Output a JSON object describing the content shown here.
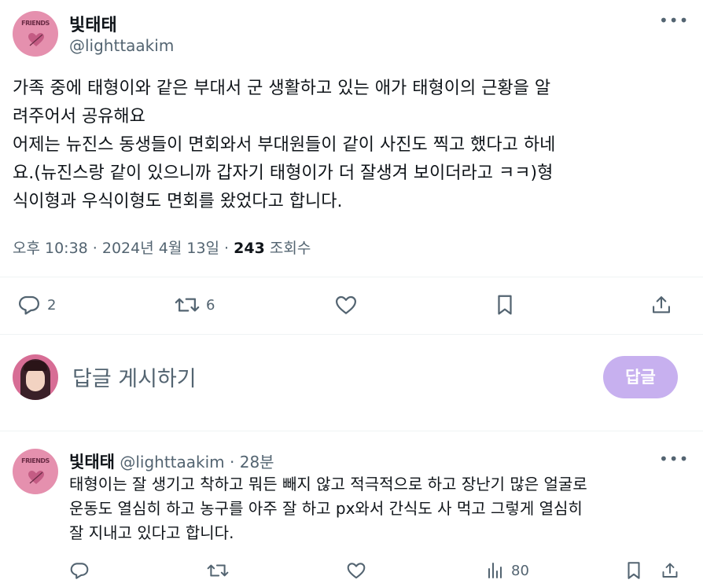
{
  "main_tweet": {
    "author_name": "빛태태",
    "author_handle": "@lighttaakim",
    "avatar_text": "FRIENDS",
    "text": "가족 중에 태형이와 같은 부대서 군 생활하고 있는 애가 태형이의 근황을 알\n려주어서 공유해요\n어제는 뉴진스 동생들이 면회와서  부대원들이 같이 사진도 찍고 했다고 하네\n요.(뉴진스랑 같이 있으니까 갑자기 태형이가 더 잘생겨 보이더라고 ㅋㅋ)형\n식이형과 우식이형도 면회를 왔었다고 합니다.",
    "timestamp": "오후 10:38 · 2024년 4월 13일 ·",
    "views_count": "243",
    "views_label": "조회수",
    "replies_count": "2",
    "retweets_count": "6"
  },
  "composer": {
    "placeholder": "답글 게시하기",
    "button_label": "답글"
  },
  "reply": {
    "author_name": "빛태태",
    "author_handle": "@lighttaakim",
    "time": "· 28분",
    "avatar_text": "FRIENDS",
    "text": "태형이는 잘 생기고 착하고 뭐든 빼지 않고 적극적으로 하고 장난기 많은 얼굴로\n운동도 열심히 하고 농구를 아주 잘 하고 px와서 간식도 사 먹고 그렇게 열심히\n잘 지내고 있다고 합니다.",
    "views_count": "80"
  },
  "colors": {
    "text_primary": "#0f1419",
    "text_secondary": "#536471",
    "reply_button": "#c7b0ef",
    "avatar_bg": "#e590ae"
  },
  "icons": [
    "more-icon",
    "reply-icon",
    "retweet-icon",
    "like-icon",
    "bookmark-icon",
    "share-icon",
    "views-icon"
  ]
}
